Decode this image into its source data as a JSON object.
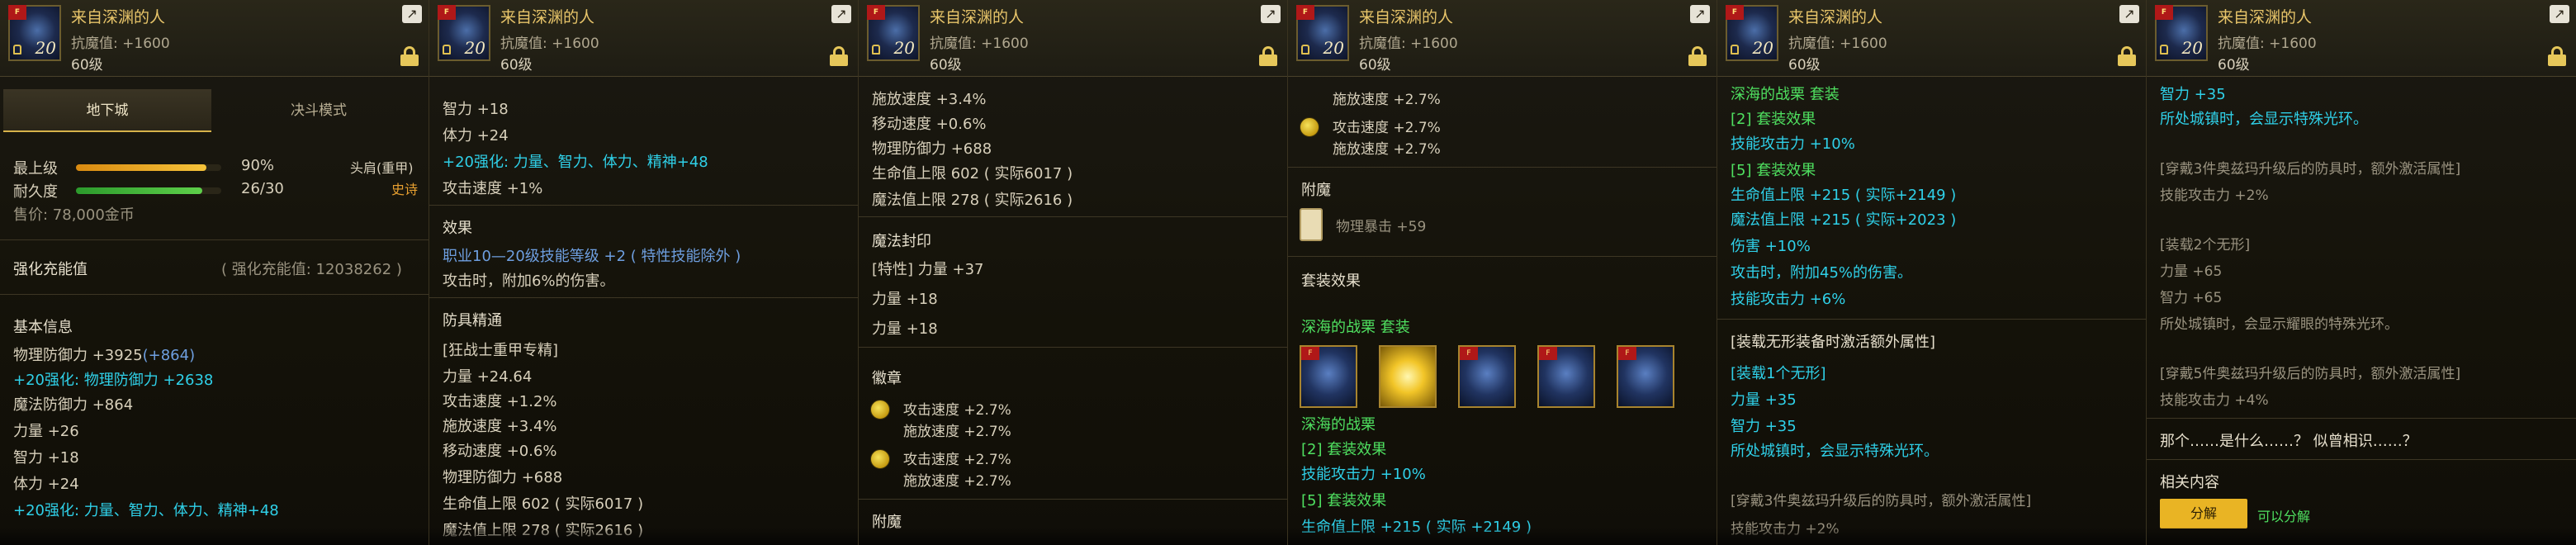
{
  "header": {
    "item_name": "来自深渊的人",
    "resist": "抗魔值: +1600",
    "level": "60级",
    "icon_tag": "F",
    "icon_level": "20",
    "share_icon": "share-icon",
    "lock_icon": "lock-icon"
  },
  "p1": {
    "tabs": [
      "地下城",
      "决斗模式"
    ],
    "grade_label": "最上级",
    "grade_value": "90%",
    "grade_fill": 0.9,
    "durability_label": "耐久度",
    "durability_value": "26/30",
    "durability_fill": 0.867,
    "price": "售价: 78,000金币",
    "slot": "头肩(重甲)",
    "rarity": "史诗",
    "reinforce_label": "强化充能值",
    "reinforce_value": "( 强化充能值: 12038262 )",
    "basic_info": "基本信息",
    "phys_def": "物理防御力 +3925",
    "phys_def_bonus": "(+864)",
    "r20_phys": "+20强化: 物理防御力 +2638",
    "mag_def": "魔法防御力 +864",
    "str": "力量 +26",
    "int": "智力 +18",
    "vit": "体力 +24",
    "r20_stats": "+20强化: 力量、智力、体力、精神+48"
  },
  "p2": {
    "int": "智力 +18",
    "vit": "体力 +24",
    "r20_stats": "+20强化: 力量、智力、体力、精神+48",
    "atk_speed": "攻击速度 +1%",
    "effect_title": "效果",
    "skill_up": "职业10—20级技能等级 +2 ( 特性技能除外 )",
    "atk_extra": "攻击时，附加6%的伤害。",
    "mastery_title": "防具精通",
    "mastery_sub": "[狂战士重甲专精]",
    "str": "力量 +24.64",
    "atk_speed2": "攻击速度 +1.2%",
    "cast_speed": "施放速度 +3.4%",
    "move_speed": "移动速度 +0.6%",
    "phys_def": "物理防御力 +688",
    "hp": "生命值上限 602 ( 实际6017 )",
    "mp_cut": "魔法值上限 278 ( 实际2616 )"
  },
  "p3": {
    "cast_speed": "施放速度 +3.4%",
    "move_speed": "移动速度 +0.6%",
    "phys_def": "物理防御力 +688",
    "hp": "生命值上限 602 ( 实际6017 )",
    "mp": "魔法值上限 278 ( 实际2616 )",
    "seal_title": "魔法封印",
    "seal_line": "[特性] 力量 +37",
    "seal_str1": "力量 +18",
    "seal_str2": "力量 +18",
    "emblem_title": "徽章",
    "emblem_atk1": "攻击速度 +2.7%",
    "emblem_cast1": "施放速度 +2.7%",
    "emblem_atk2": "攻击速度 +2.7%",
    "emblem_cast2": "施放速度 +2.7%",
    "enchant_title": "附魔"
  },
  "p4": {
    "cast_top": "施放速度 +2.7%",
    "atk": "攻击速度 +2.7%",
    "cast": "施放速度 +2.7%",
    "enchant_title": "附魔",
    "crit": "物理暴击 +59",
    "set_title": "套装效果",
    "set_name": "深海的战栗",
    "set_tag": "套装",
    "set_name2": "深海的战栗",
    "set2_label": "[2] 套装效果",
    "set2_line": "技能攻击力 +10%",
    "set5_label": "[5] 套装效果",
    "set5_cut": "生命值上限 +215 ( 实际 +2149 )"
  },
  "p5": {
    "set_top": "深海的战栗  套装",
    "set2_label": "[2] 套装效果",
    "set2_line": "技能攻击力 +10%",
    "set5_label": "[5] 套装效果",
    "hp": "生命值上限 +215 ( 实际+2149 )",
    "mp": "魔法值上限 +215 ( 实际+2023 )",
    "dmg": "伤害 +10%",
    "atk_extra": "攻击时，附加45%的伤害。",
    "skill_atk": "技能攻击力 +6%",
    "shapeless_title": "[装载无形装备时激活额外属性]",
    "shapeless_1": "[装载1个无形]",
    "shapeless_str": "力量 +35",
    "shapeless_int": "智力 +35",
    "shapeless_town": "所处城镇时，会显示特殊光环。",
    "ozma_note": "[穿戴3件奥兹玛升级后的防具时，额外激活属性]",
    "ozma_cut": "技能攻击力 +2%"
  },
  "p6": {
    "int_top": "智力 +35",
    "town": "所处城镇时，会显示特殊光环。",
    "ozma3": "[穿戴3件奥兹玛升级后的防具时，额外激活属性]",
    "ozma3_line": "技能攻击力 +2%",
    "shape2": "[装载2个无形]",
    "shape2_str": "力量 +65",
    "shape2_int": "智力 +65",
    "shape2_town": "所处城镇时，会显示耀眼的特殊光环。",
    "ozma5": "[穿戴5件奥兹玛升级后的防具时，额外激活属性]",
    "ozma5_line": "技能攻击力 +4%",
    "flavor": "那个……是什么……？ 似曾相识……？",
    "related": "相关内容",
    "decompose_btn": "分解",
    "can_decompose": "可以分解"
  },
  "colors": {
    "cyan": "#2fd0e8",
    "gold": "#e6c05a",
    "rarity_orange": "#e8a030",
    "accent_yellow": "#e9b424"
  }
}
